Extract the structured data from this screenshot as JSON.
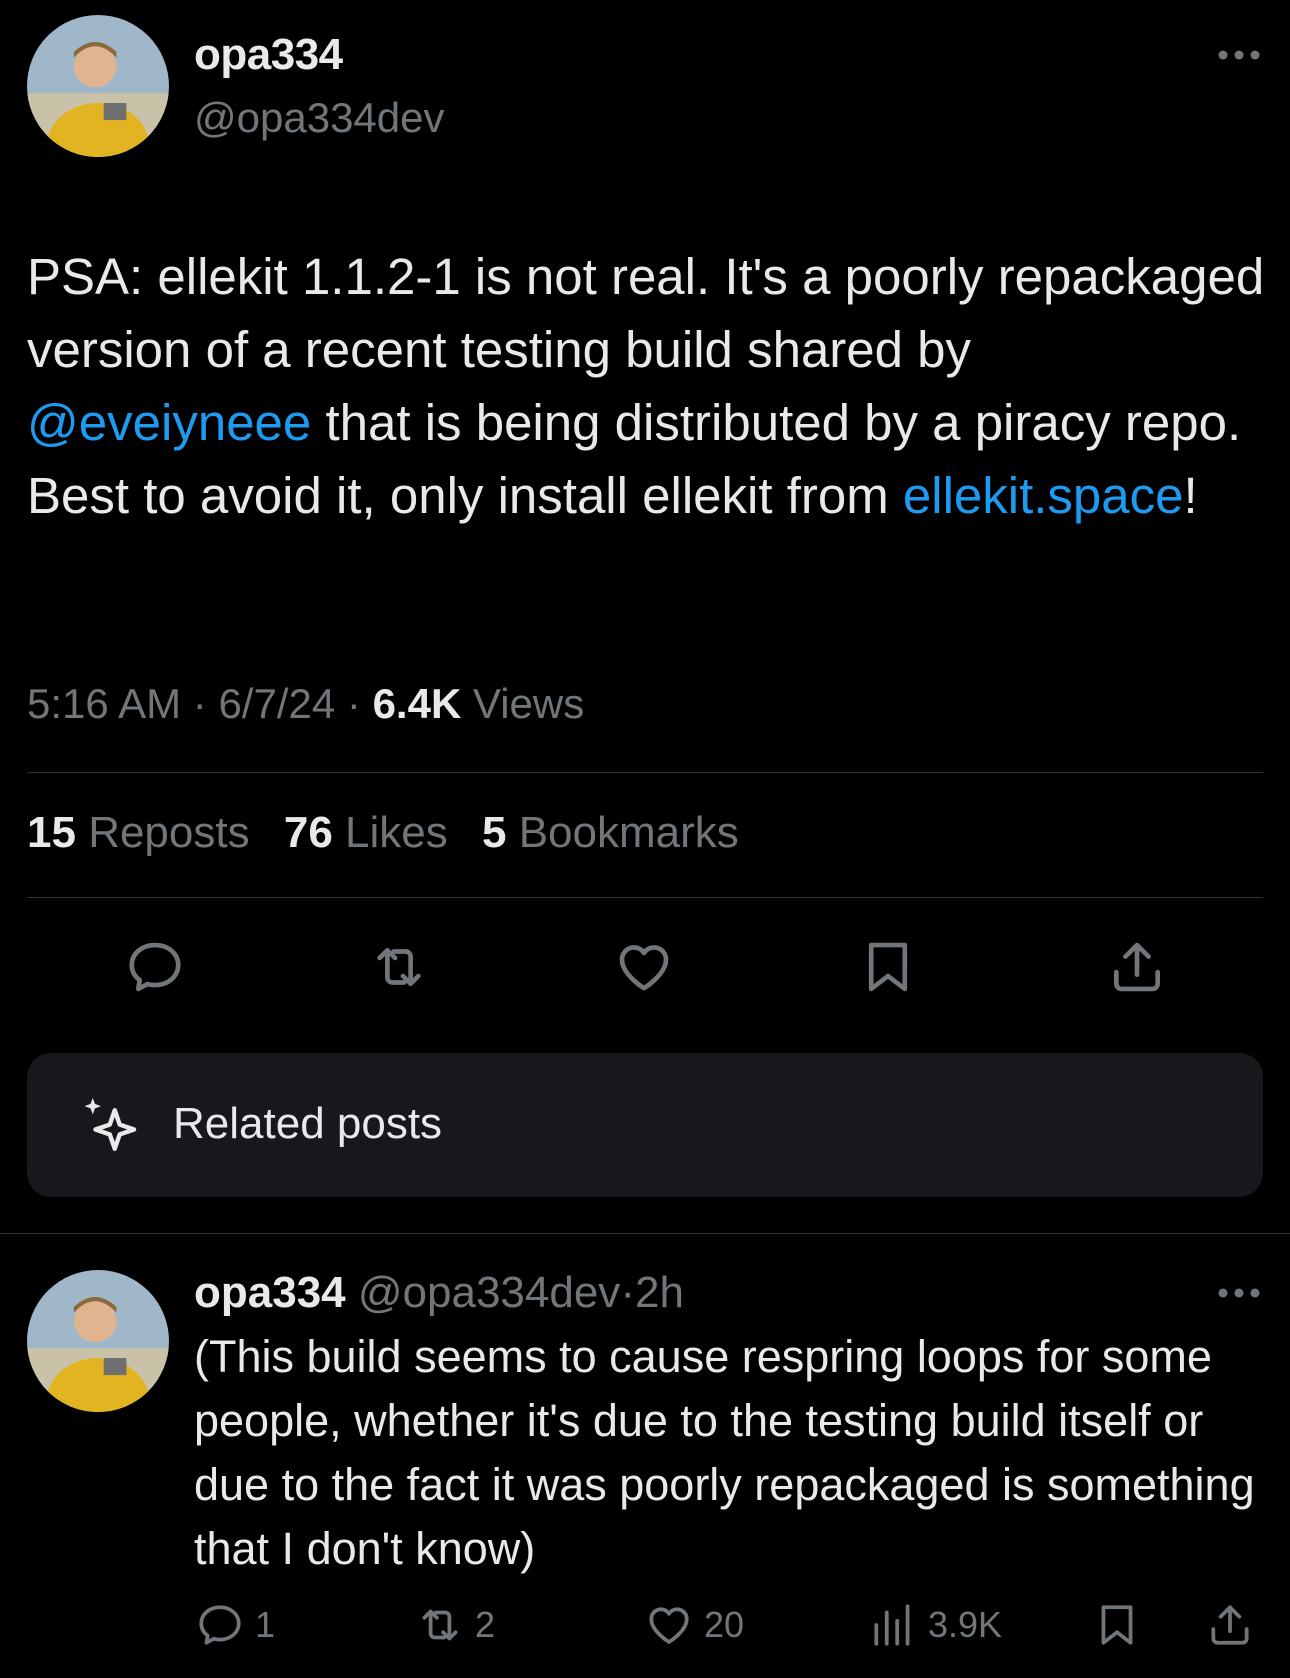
{
  "tweet": {
    "display_name": "opa334",
    "handle": "@opa334dev",
    "text_part1": "PSA: ellekit 1.1.2-1 is not real. It's a poorly repackaged version of a recent testing build shared by ",
    "mention": "@eveiyneee",
    "text_part2": " that is being distributed by a piracy repo. Best to avoid it, only install ellekit from ",
    "link": "ellekit.space",
    "text_part3": "!",
    "time": "5:16 AM",
    "date": "6/7/24",
    "views_count": "6.4K",
    "views_label": "Views",
    "separator": "·"
  },
  "stats": {
    "reposts_count": "15",
    "reposts_label": "Reposts",
    "likes_count": "76",
    "likes_label": "Likes",
    "bookmarks_count": "5",
    "bookmarks_label": "Bookmarks"
  },
  "related": {
    "label": "Related posts"
  },
  "reply": {
    "display_name": "opa334",
    "handle": "@opa334dev",
    "age": "2h",
    "separator": "·",
    "text": "(This build seems to cause respring loops for some people, whether it's due to the testing build itself or due to the fact it was poorly repackaged is something that I don't know)",
    "replies": "1",
    "reposts": "2",
    "likes": "20",
    "views": "3.9K"
  },
  "colors": {
    "background": "#000000",
    "text_primary": "#e7e9ea",
    "text_secondary": "#71767b",
    "link": "#1d9bf0",
    "divider": "#2f3336",
    "card": "#16181c"
  },
  "icons": {
    "more": "more-horizontal-icon",
    "reply": "reply-icon",
    "repost": "repost-icon",
    "like": "heart-icon",
    "bookmark": "bookmark-icon",
    "share": "share-icon",
    "related": "sparkle-icon",
    "views": "views-chart-icon"
  }
}
